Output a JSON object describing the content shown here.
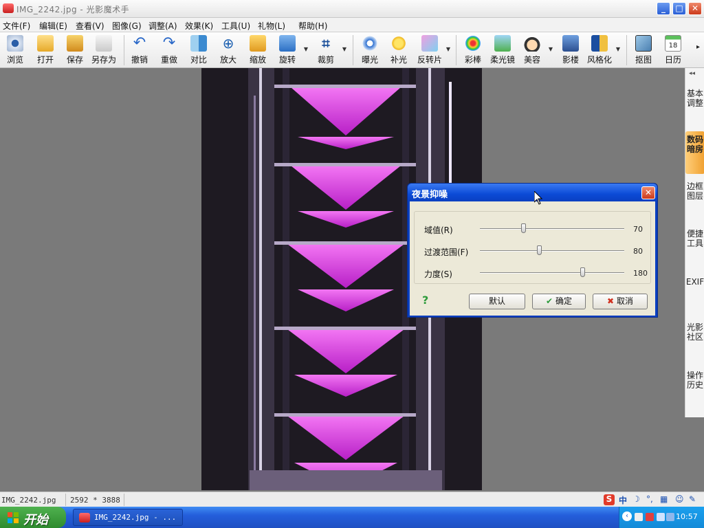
{
  "window": {
    "title": "IMG_2242.jpg - 光影魔术手",
    "controls": {
      "minimize": "_",
      "maximize": "□",
      "close": "✕"
    }
  },
  "menu": [
    {
      "label": "文件(F)"
    },
    {
      "label": "编辑(E)"
    },
    {
      "label": "查看(V)"
    },
    {
      "label": "图像(G)"
    },
    {
      "label": "调整(A)"
    },
    {
      "label": "效果(K)"
    },
    {
      "label": "工具(U)"
    },
    {
      "label": "礼物(L)"
    },
    {
      "label": "帮助(H)"
    }
  ],
  "toolbar": [
    {
      "label": "浏览",
      "icon": "eye-icon"
    },
    {
      "label": "打开",
      "icon": "folder-open-icon"
    },
    {
      "label": "保存",
      "icon": "save-icon"
    },
    {
      "label": "另存为",
      "icon": "save-as-icon"
    },
    {
      "label": "撤销",
      "icon": "undo-icon"
    },
    {
      "label": "重做",
      "icon": "redo-icon"
    },
    {
      "label": "对比",
      "icon": "compare-icon"
    },
    {
      "label": "放大",
      "icon": "zoom-in-icon"
    },
    {
      "label": "缩放",
      "icon": "resize-icon"
    },
    {
      "label": "旋转",
      "icon": "rotate-icon"
    },
    {
      "label": "裁剪",
      "icon": "crop-icon"
    },
    {
      "label": "曝光",
      "icon": "exposure-icon"
    },
    {
      "label": "补光",
      "icon": "fill-light-icon"
    },
    {
      "label": "反转片",
      "icon": "reversal-film-icon"
    },
    {
      "label": "彩棒",
      "icon": "color-wand-icon"
    },
    {
      "label": "柔光镜",
      "icon": "soft-focus-icon"
    },
    {
      "label": "美容",
      "icon": "beauty-icon"
    },
    {
      "label": "影楼",
      "icon": "studio-icon"
    },
    {
      "label": "风格化",
      "icon": "stylize-icon"
    },
    {
      "label": "抠图",
      "icon": "cutout-icon"
    },
    {
      "label": "日历",
      "icon": "calendar-icon",
      "badge": "18"
    }
  ],
  "right_panel": {
    "tabs": [
      {
        "label": "基本调整",
        "active": false
      },
      {
        "label": "数码暗房",
        "active": true
      },
      {
        "label": "边框图层",
        "active": false
      },
      {
        "label": "便捷工具",
        "active": false
      },
      {
        "label": "EXIF",
        "active": false
      },
      {
        "label": "光影社区",
        "active": false
      },
      {
        "label": "操作历史",
        "active": false
      }
    ]
  },
  "dialog": {
    "title": "夜景抑噪",
    "close": "✕",
    "sliders": [
      {
        "label": "域值(R)",
        "value": "70",
        "position": 0.3
      },
      {
        "label": "过渡范围(F)",
        "value": "80",
        "position": 0.41
      },
      {
        "label": "力度(S)",
        "value": "180",
        "position": 0.71
      }
    ],
    "help": "?",
    "buttons": {
      "default": "默认",
      "ok": "确定",
      "cancel": "取消",
      "ok_icon": "✔",
      "cancel_icon": "✖"
    }
  },
  "status": {
    "filename": "IMG_2242.jpg",
    "dimensions": "2592 * 3888",
    "ime": "中"
  },
  "taskbar": {
    "start": "开始",
    "task": "IMG_2242.jpg - ...",
    "clock": "10:57"
  },
  "colors": {
    "accent": "#0a3fc0",
    "photo_glow": "#e040f0",
    "panel_active": "#f0a030"
  }
}
